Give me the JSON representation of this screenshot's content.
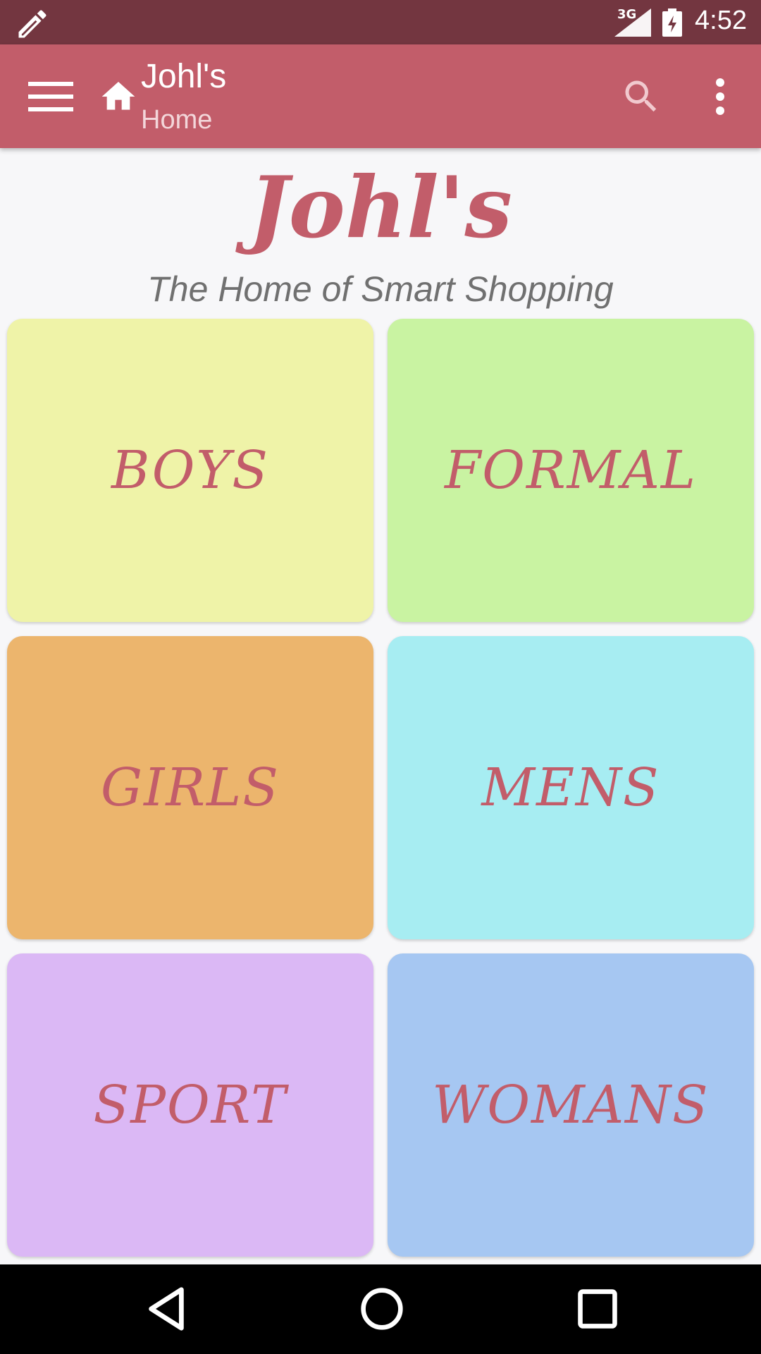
{
  "status_bar": {
    "network": "3G",
    "time": "4:52",
    "icons": [
      "pencil-icon",
      "signal-icon",
      "battery-icon"
    ]
  },
  "app_bar": {
    "title": "Johl's",
    "subtitle": "Home",
    "icons": [
      "menu-icon",
      "home-icon",
      "search-icon",
      "more-vert-icon"
    ]
  },
  "header": {
    "logo": "Johl's",
    "tagline": "The Home of Smart Shopping"
  },
  "categories": [
    {
      "label": "BOYS",
      "color": "#eff3a8"
    },
    {
      "label": "FORMAL",
      "color": "#c9f3a2"
    },
    {
      "label": "GIRLS",
      "color": "#ecb56d"
    },
    {
      "label": "MENS",
      "color": "#a7edf2"
    },
    {
      "label": "SPORT",
      "color": "#dbb8f5"
    },
    {
      "label": "WOMANS",
      "color": "#a6c7f2"
    }
  ],
  "theme": {
    "accent": "#c25d6a",
    "status_bar": "#733640"
  },
  "nav_bar": {
    "icons": [
      "back-icon",
      "home-circle-icon",
      "recents-icon"
    ]
  }
}
